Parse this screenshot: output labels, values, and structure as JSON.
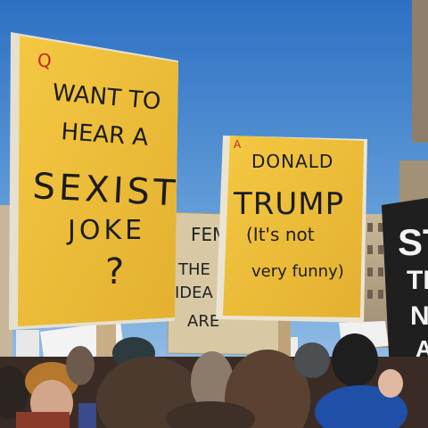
{
  "scene": "protest-crowd-with-placards",
  "colors": {
    "sky_top": "#2f74c6",
    "sky_bottom": "#9cc3e8",
    "placard_yellow": "#f1c23c",
    "placard_shadow": "#d9a92a",
    "ink": "#1c1c1c",
    "red_mark": "#c62828"
  },
  "sign_left": {
    "corner_mark": "Q",
    "lines": [
      "WANT TO",
      "HEAR A",
      "SEXIST",
      "JOKE",
      "?"
    ]
  },
  "sign_right": {
    "corner_mark": "A",
    "lines": [
      "DONALD",
      "TRUMP",
      "(It's not",
      "very funny)"
    ]
  },
  "sign_back": {
    "lines": [
      "FEM",
      "THE",
      "IDEA",
      "ARE"
    ]
  },
  "sign_edge": {
    "lines": [
      "ST",
      "TE",
      "N",
      "A"
    ]
  }
}
